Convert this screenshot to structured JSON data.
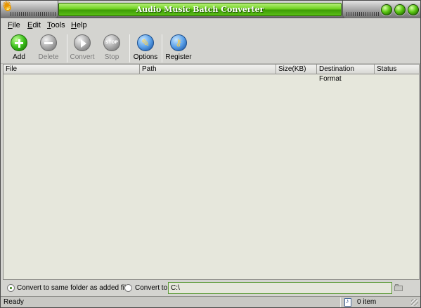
{
  "window": {
    "title": "Audio Music Batch Converter"
  },
  "menu": {
    "file": {
      "key": "F",
      "rest": "ile"
    },
    "edit": {
      "key": "E",
      "rest": "dit"
    },
    "tools": {
      "key": "T",
      "rest": "ools"
    },
    "help": {
      "key": "H",
      "rest": "elp"
    }
  },
  "toolbar": {
    "add_label": "Add",
    "delete_label": "Delete",
    "convert_label": "Convert",
    "stop_label": "Stop",
    "stop_icon_text": "STOP",
    "options_label": "Options",
    "register_label": "Register"
  },
  "file_list": {
    "columns": [
      "File",
      "Path",
      "Size(KB)",
      "Destination Format",
      "Status"
    ],
    "rows": []
  },
  "output": {
    "same_folder_label": "Convert to same folder as added file",
    "same_folder_selected": true,
    "convert_to_label": "Convert to",
    "convert_to_selected": false,
    "path_value": "C:\\"
  },
  "status": {
    "text": "Ready",
    "count": "0 item"
  },
  "colors": {
    "title_green": "#6fd11e",
    "list_background": "#e6e7dc",
    "window_gray": "#d4d4d0"
  },
  "icons": {
    "app": "sun-icon",
    "add": "plus-circle-icon",
    "delete": "minus-circle-icon",
    "convert": "play-circle-icon",
    "stop": "stop-circle-icon",
    "options": "wrench-icon",
    "register": "key-icon",
    "browse": "folder-icon",
    "status": "audio-document-icon"
  }
}
